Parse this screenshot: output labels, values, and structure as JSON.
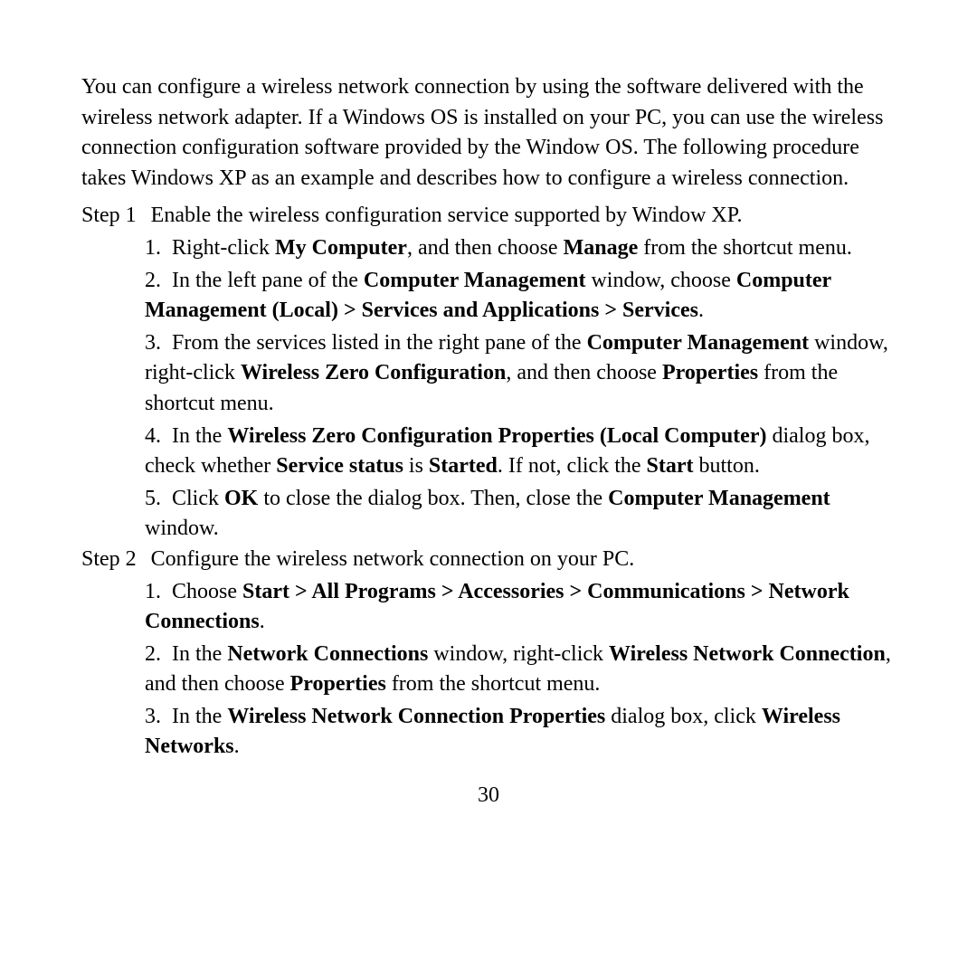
{
  "intro": "You can configure a wireless network connection by using the software delivered with the wireless network adapter. If a Windows OS is installed on your PC, you can use the wireless connection configuration software provided by the Window OS. The following procedure takes Windows XP as an example and describes how to configure a wireless connection.",
  "steps": [
    {
      "label": "Step 1",
      "title": "Enable the wireless configuration service supported by Window XP.",
      "subs": [
        {
          "num": "1.",
          "pre": "Right-click ",
          "b1": "My Computer",
          "mid1": ", and then choose ",
          "b2": "Manage",
          "post": " from the shortcut menu."
        },
        {
          "num": "2.",
          "pre": "In the left pane of the ",
          "b1": "Computer Management",
          "mid1": " window, choose ",
          "b2": "Computer Management (Local) > Services and Applications > Services",
          "post": "."
        },
        {
          "num": "3.",
          "pre": "From the services listed in the right pane of the ",
          "b1": "Computer Management",
          "mid1": " window, right-click ",
          "b2": "Wireless Zero Configuration",
          "mid2": ", and then choose ",
          "b3": "Properties",
          "post": " from the shortcut menu."
        },
        {
          "num": "4.",
          "pre": "In the ",
          "b1": "Wireless Zero Configuration Properties (Local Computer)",
          "mid1": " dialog box, check whether ",
          "b2": "Service status",
          "mid2": " is ",
          "b3": "Started",
          "mid3": ". If not, click the ",
          "b4": "Start",
          "post": " button."
        },
        {
          "num": "5.",
          "pre": "Click ",
          "b1": "OK",
          "mid1": " to close the dialog box. Then, close the ",
          "b2": "Computer Management",
          "post": " window."
        }
      ]
    },
    {
      "label": "Step 2",
      "title": "Configure the wireless network connection on your PC.",
      "subs": [
        {
          "num": "1.",
          "pre": "Choose ",
          "b1": "Start > All Programs > Accessories > Communications > Network Connections",
          "post": "."
        },
        {
          "num": "2.",
          "pre": "In the ",
          "b1": "Network Connections",
          "mid1": " window, right-click ",
          "b2": "Wireless Network Connection",
          "mid2": ", and then choose ",
          "b3": "Properties",
          "post": " from the shortcut menu."
        },
        {
          "num": "3.",
          "pre": "In the ",
          "b1": "Wireless Network Connection Properties",
          "mid1": " dialog box, click ",
          "b2": "Wireless Networks",
          "post": "."
        }
      ]
    }
  ],
  "pageNumber": "30"
}
